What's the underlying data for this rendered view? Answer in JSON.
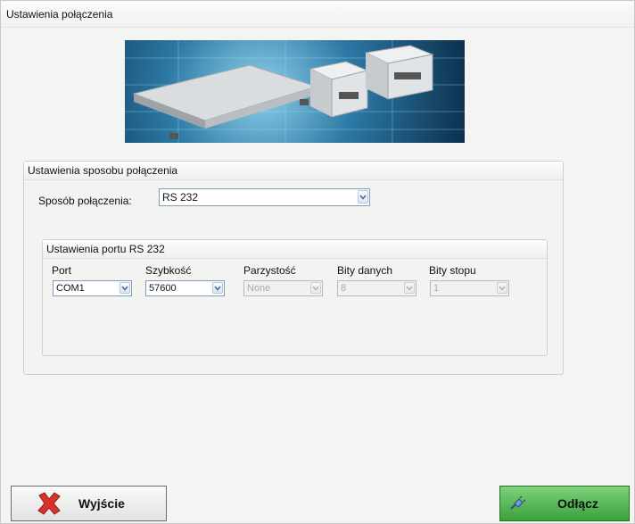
{
  "window": {
    "title": "Ustawienia połączenia"
  },
  "connection_group": {
    "title": "Ustawienia sposobu połączenia",
    "method_label": "Sposób połączenia:",
    "method_value": "RS 232"
  },
  "port_group": {
    "title": "Ustawienia portu RS 232",
    "fields": [
      {
        "label": "Port",
        "value": "COM1",
        "enabled": true
      },
      {
        "label": "Szybkość",
        "value": "57600",
        "enabled": true
      },
      {
        "label": "Parzystość",
        "value": "None",
        "enabled": false
      },
      {
        "label": "Bity danych",
        "value": "8",
        "enabled": false
      },
      {
        "label": "Bity stopu",
        "value": "1",
        "enabled": false
      }
    ]
  },
  "buttons": {
    "exit_label": "Wyjście",
    "disconnect_label": "Odłącz"
  },
  "icons": {
    "exit": "red-x-icon",
    "disconnect": "plug-icon",
    "dropdown": "chevron-down-icon"
  },
  "colors": {
    "disconnect_button": "#4fb04c",
    "exit_icon": "#d9322b",
    "combo_border": "#7f9db9"
  }
}
